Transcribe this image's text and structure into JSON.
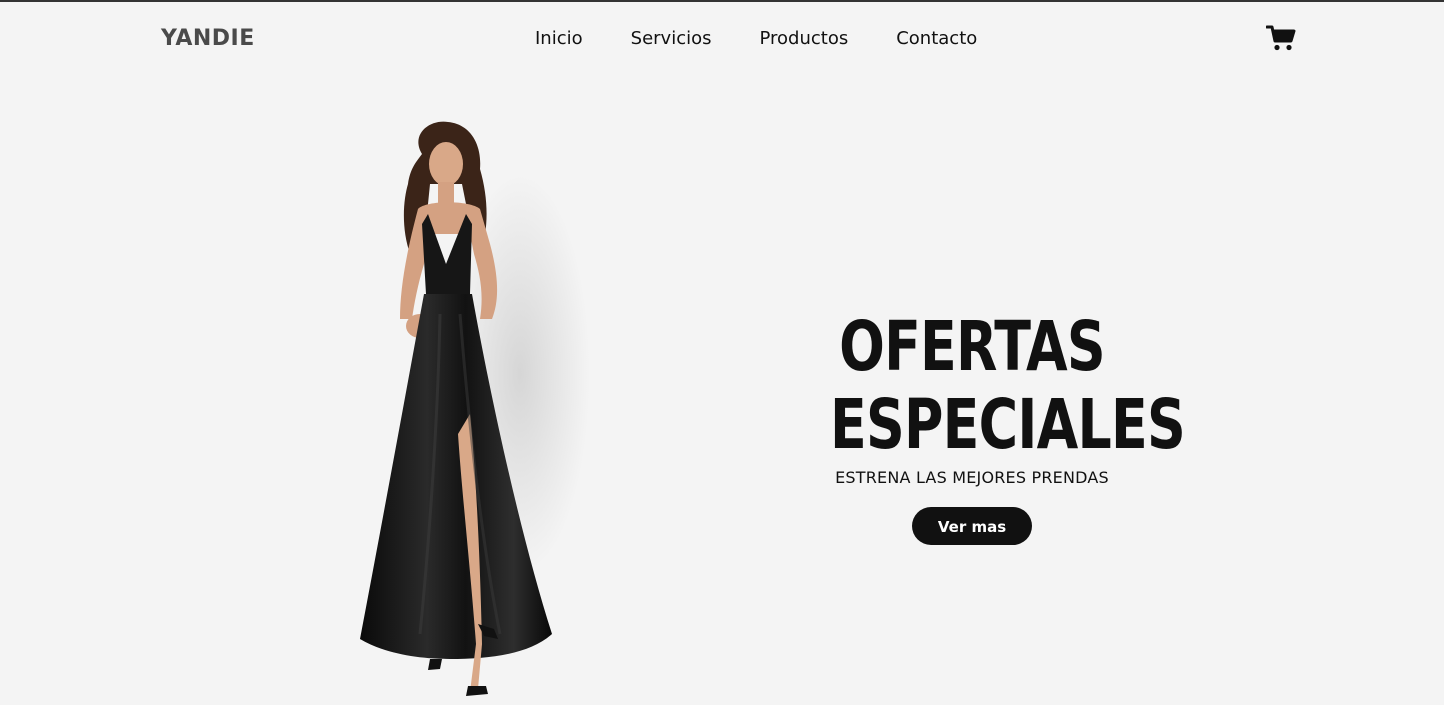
{
  "header": {
    "logo": "YANDIE",
    "nav": [
      {
        "label": "Inicio"
      },
      {
        "label": "Servicios"
      },
      {
        "label": "Productos"
      },
      {
        "label": "Contacto"
      }
    ],
    "cart_icon": "shopping-cart-icon"
  },
  "hero": {
    "title_line1": "OFERTAS",
    "title_line2": "ESPECIALES",
    "subtitle": "ESTRENA LAS MEJORES PRENDAS",
    "button_label": "Ver mas",
    "image": "model-black-dress-image"
  },
  "colors": {
    "background": "#f4f4f4",
    "text": "#111111",
    "logo": "#4a4a4a",
    "button_bg": "#111111",
    "button_text": "#ffffff"
  }
}
